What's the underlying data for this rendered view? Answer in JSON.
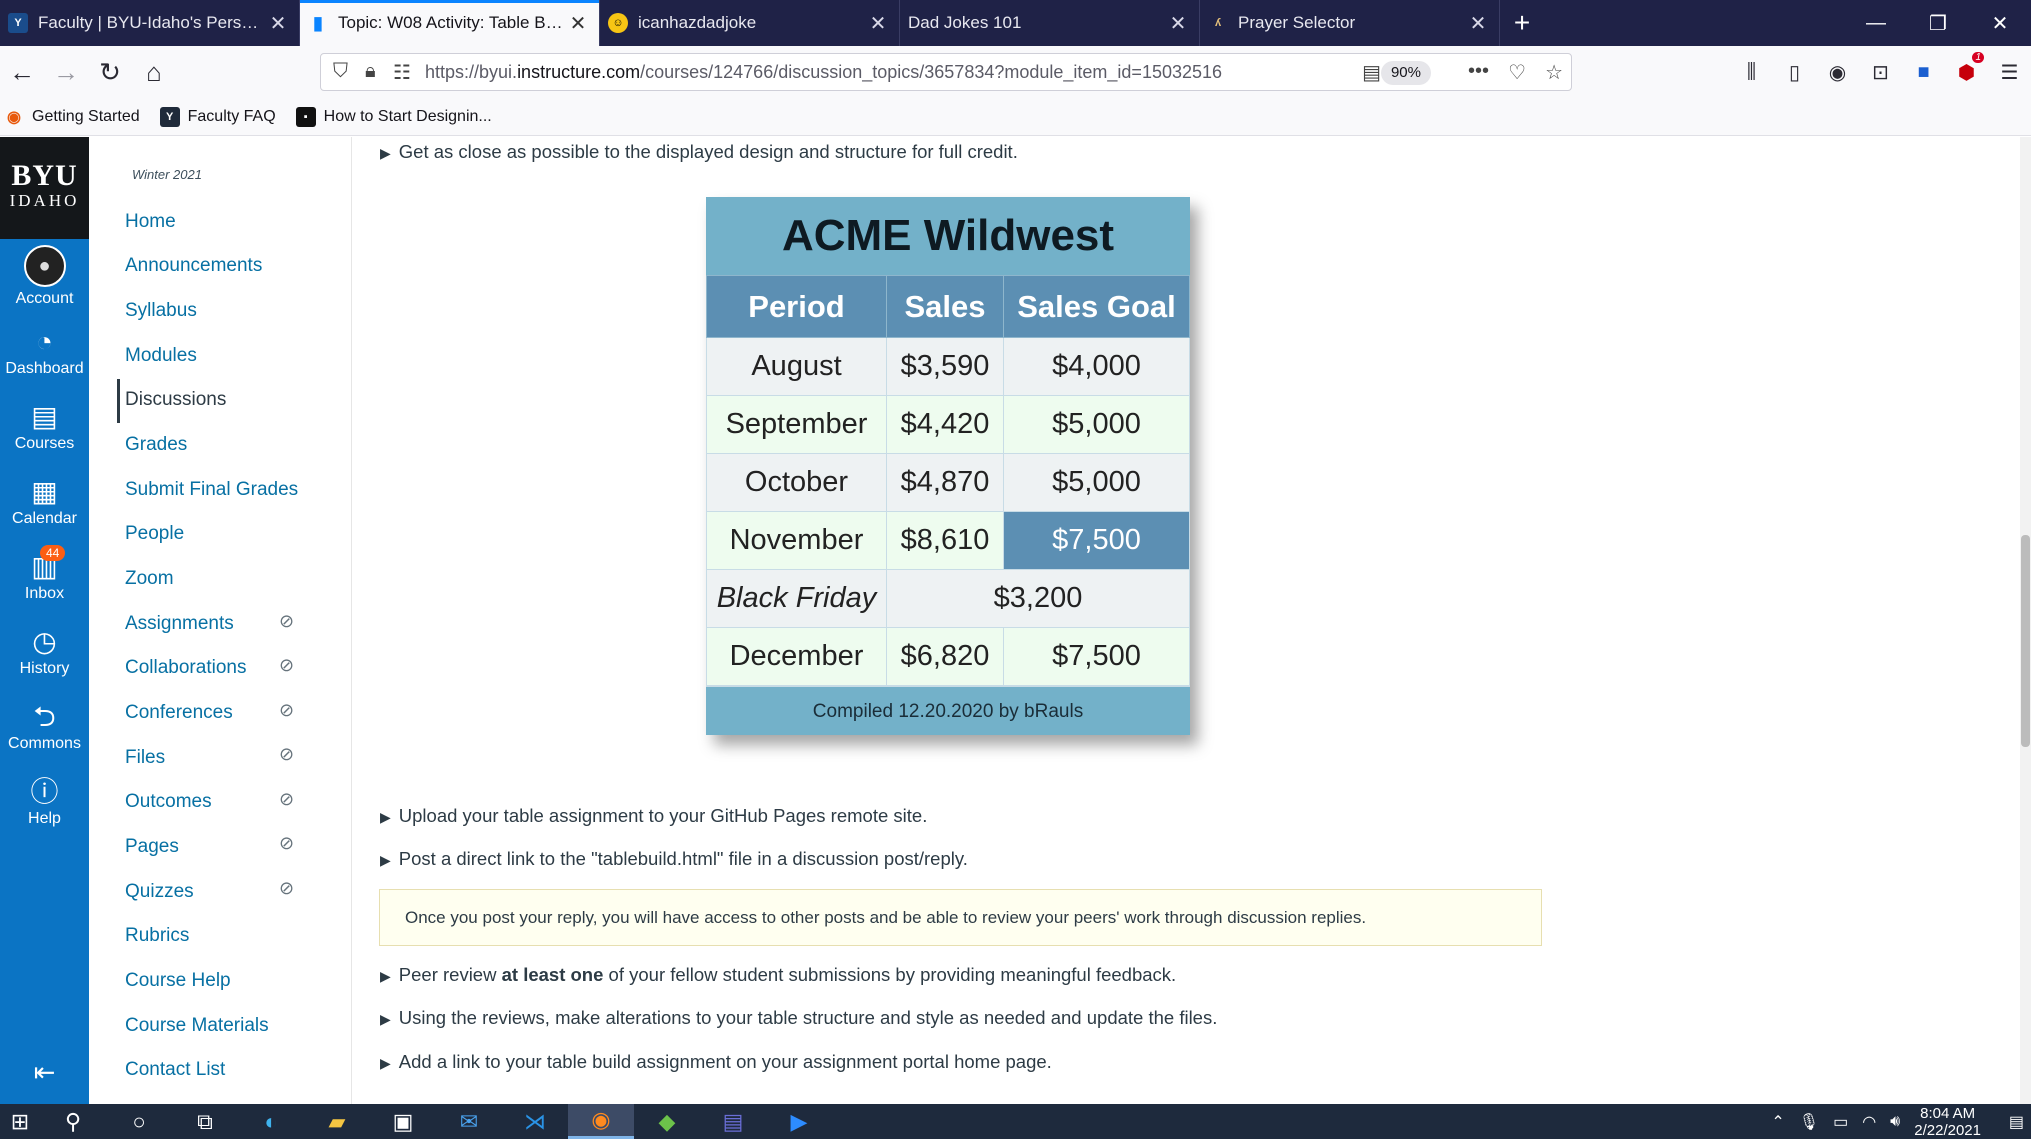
{
  "tabs": [
    {
      "title": "Faculty | BYU-Idaho's Personaliz",
      "active": false
    },
    {
      "title": "Topic: W08 Activity: Table Build",
      "active": true
    },
    {
      "title": "icanhazdadjoke",
      "active": false
    },
    {
      "title": "Dad Jokes 101",
      "active": false
    },
    {
      "title": "Prayer Selector",
      "active": false
    }
  ],
  "new_tab": "+",
  "url": {
    "prefix": "https://byui.",
    "domain": "instructure.com",
    "path": "/courses/124766/discussion_topics/3657834?module_item_id=15032516"
  },
  "zoom": "90%",
  "bookmarks": [
    "Getting Started",
    "Faculty FAQ",
    "How to Start Designin..."
  ],
  "global_nav": {
    "logo_line1": "BYU",
    "logo_line2": "IDAHO",
    "items": [
      {
        "label": "Account",
        "icon": "avatar"
      },
      {
        "label": "Dashboard",
        "icon": "dashboard-icon"
      },
      {
        "label": "Courses",
        "icon": "courses-icon"
      },
      {
        "label": "Calendar",
        "icon": "calendar-icon"
      },
      {
        "label": "Inbox",
        "icon": "inbox-icon",
        "badge": "44"
      },
      {
        "label": "History",
        "icon": "history-icon"
      },
      {
        "label": "Commons",
        "icon": "commons-icon"
      },
      {
        "label": "Help",
        "icon": "help-icon"
      }
    ],
    "collapse_icon": "collapse-icon"
  },
  "course_nav": {
    "term": "Winter 2021",
    "items": [
      {
        "label": "Home",
        "hidden": false
      },
      {
        "label": "Announcements",
        "hidden": false
      },
      {
        "label": "Syllabus",
        "hidden": false
      },
      {
        "label": "Modules",
        "hidden": false
      },
      {
        "label": "Discussions",
        "hidden": false,
        "active": true
      },
      {
        "label": "Grades",
        "hidden": false
      },
      {
        "label": "Submit Final Grades",
        "hidden": false
      },
      {
        "label": "People",
        "hidden": false
      },
      {
        "label": "Zoom",
        "hidden": false
      },
      {
        "label": "Assignments",
        "hidden": true
      },
      {
        "label": "Collaborations",
        "hidden": true
      },
      {
        "label": "Conferences",
        "hidden": true
      },
      {
        "label": "Files",
        "hidden": true
      },
      {
        "label": "Outcomes",
        "hidden": true
      },
      {
        "label": "Pages",
        "hidden": true
      },
      {
        "label": "Quizzes",
        "hidden": true
      },
      {
        "label": "Rubrics",
        "hidden": false
      },
      {
        "label": "Course Help",
        "hidden": false
      },
      {
        "label": "Course Materials",
        "hidden": false
      },
      {
        "label": "Contact List",
        "hidden": false
      }
    ]
  },
  "content": {
    "bullet_top": "Get as close as possible to the displayed design and structure for full credit.",
    "acme": {
      "title": "ACME Wildwest",
      "headers": [
        "Period",
        "Sales",
        "Sales Goal"
      ],
      "rows": [
        {
          "period": "August",
          "sales": "$3,590",
          "goal": "$4,000"
        },
        {
          "period": "September",
          "sales": "$4,420",
          "goal": "$5,000"
        },
        {
          "period": "October",
          "sales": "$4,870",
          "goal": "$5,000"
        },
        {
          "period": "November",
          "sales": "$8,610",
          "goal": "$7,500"
        },
        {
          "period": "Black Friday",
          "merged": "$3,200"
        },
        {
          "period": "December",
          "sales": "$6,820",
          "goal": "$7,500"
        }
      ],
      "caption": "Compiled 12.20.2020 by bRauls"
    },
    "bullets_mid": [
      "Upload your table assignment to your GitHub Pages remote site.",
      "Post a direct link to the \"tablebuild.html\" file in a discussion post/reply."
    ],
    "notice": "Once you post your reply, you will have access to other posts and be able to review your peers' work through discussion replies.",
    "bullet_peer_pre": "Peer review ",
    "bullet_peer_bold": "at least one",
    "bullet_peer_post": " of your fellow student submissions by providing meaningful feedback.",
    "bullets_end": [
      "Using the reviews, make alterations to your table structure and style as needed and update the files.",
      "Add a link to your table build assignment on your assignment portal home page."
    ]
  },
  "taskbar": {
    "clock_time": "8:04 AM",
    "clock_date": "2/22/2021"
  },
  "colors": {
    "canvas_blue": "#0b74c4",
    "link": "#0770a3",
    "table_header": "#5c8fb3",
    "table_title": "#73b1c9"
  }
}
